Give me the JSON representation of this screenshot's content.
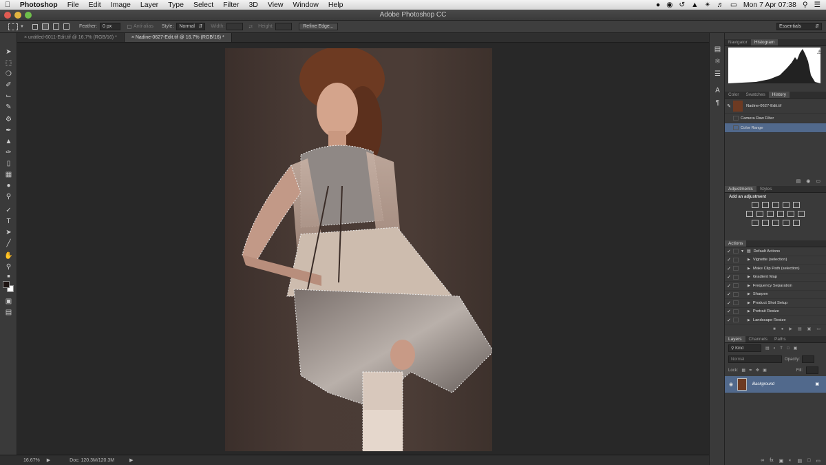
{
  "menubar": {
    "app": "Photoshop",
    "items": [
      "File",
      "Edit",
      "Image",
      "Layer",
      "Type",
      "Select",
      "Filter",
      "3D",
      "View",
      "Window",
      "Help"
    ],
    "datetime": "Mon 7 Apr  07:38"
  },
  "window": {
    "title": "Adobe Photoshop CC"
  },
  "options": {
    "feather_label": "Feather:",
    "feather_value": "0 px",
    "anti_alias": "Anti-alias",
    "style_label": "Style:",
    "style_value": "Normal",
    "width_label": "Width:",
    "height_label": "Height:",
    "refine_edge": "Refine Edge...",
    "workspace": "Essentials"
  },
  "tabs": [
    {
      "label": "untitled-6011-Edit.tif @ 16.7% (RGB/16) *",
      "active": false
    },
    {
      "label": "Nadine-0627-Edit.tif @ 16.7% (RGB/16) *",
      "active": true
    }
  ],
  "status": {
    "zoom": "16.67%",
    "doc": "Doc: 120.3M/120.3M"
  },
  "navigator": {
    "tabs": [
      "Navigator",
      "Histogram"
    ],
    "active": "Histogram"
  },
  "history": {
    "tabs": [
      "Color",
      "Swatches",
      "History"
    ],
    "active": "History",
    "snapshot": "Nadine-0627-Edit.tif",
    "items": [
      "Camera Raw Filter",
      "Color Range"
    ],
    "selected": "Color Range"
  },
  "adjustments": {
    "tabs": [
      "Adjustments",
      "Styles"
    ],
    "heading": "Add an adjustment"
  },
  "actions": {
    "tab": "Actions",
    "set": "Default Actions",
    "items": [
      "Vignette (selection)",
      "Make Clip Path (selection)",
      "Gradient Map",
      "Frequency Separation",
      "Sharpen",
      "Product Shot Setup",
      "Portrait Resize",
      "Landscape Resize"
    ]
  },
  "layers": {
    "tabs": [
      "Layers",
      "Channels",
      "Paths"
    ],
    "active": "Layers",
    "kind": "Kind",
    "blend": "Normal",
    "opacity_label": "Opacity:",
    "lock_label": "Lock:",
    "fill_label": "Fill:",
    "layer_name": "Background"
  },
  "colors": {
    "accent": "#8ea7c9",
    "selection": "#51698c",
    "photo_bg": "#463831"
  }
}
